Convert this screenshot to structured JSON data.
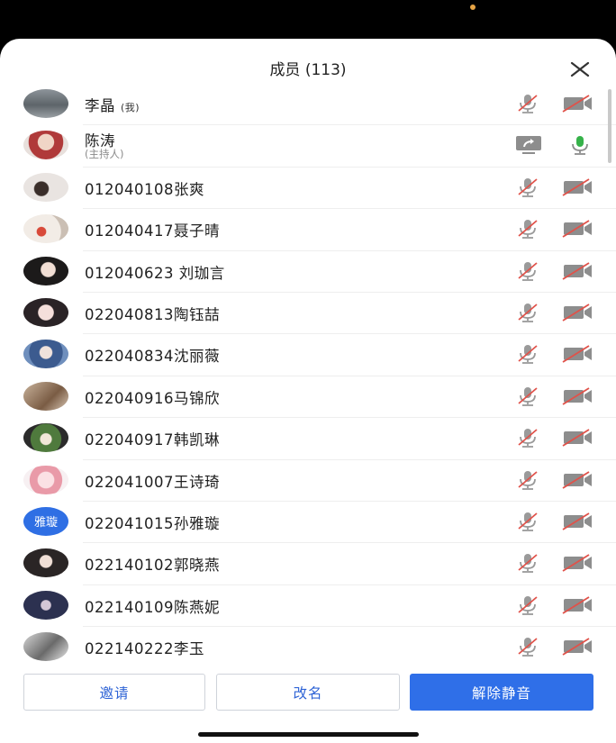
{
  "header": {
    "title": "成员 (113)",
    "close_icon": "close-icon"
  },
  "members": [
    {
      "name": "李晶",
      "tag": "(我)",
      "avatar": "photo-gray",
      "mic": "muted",
      "camera": "off"
    },
    {
      "name": "陈涛",
      "subtitle": "(主持人)",
      "avatar": "photo-red",
      "mic": "active",
      "camera": "screen-share"
    },
    {
      "name": "012040108张爽",
      "avatar": "photo-light",
      "mic": "muted",
      "camera": "off"
    },
    {
      "name": "012040417聂子晴",
      "avatar": "photo-beige",
      "mic": "muted",
      "camera": "off"
    },
    {
      "name": "012040623 刘珈言",
      "avatar": "photo-dark",
      "mic": "muted",
      "camera": "off"
    },
    {
      "name": "022040813陶钰喆",
      "avatar": "photo-pink",
      "mic": "muted",
      "camera": "off"
    },
    {
      "name": "022040834沈丽薇",
      "avatar": "photo-blue",
      "mic": "muted",
      "camera": "off"
    },
    {
      "name": "022040916马锦欣",
      "avatar": "photo-tan",
      "mic": "muted",
      "camera": "off"
    },
    {
      "name": "022040917韩凯琳",
      "avatar": "photo-green",
      "mic": "muted",
      "camera": "off"
    },
    {
      "name": "022041007王诗琦",
      "avatar": "photo-anime",
      "mic": "muted",
      "camera": "off"
    },
    {
      "name": "022041015孙雅璇",
      "avatar_text": "雅璇",
      "mic": "muted",
      "camera": "off"
    },
    {
      "name": "022140102郭晓燕",
      "avatar": "photo-portrait",
      "mic": "muted",
      "camera": "off"
    },
    {
      "name": "022140109陈燕妮",
      "avatar": "photo-navy",
      "mic": "muted",
      "camera": "off"
    },
    {
      "name": "022140222李玉",
      "avatar": "photo-bw",
      "mic": "muted",
      "camera": "off"
    }
  ],
  "footer": {
    "invite_label": "邀请",
    "rename_label": "改名",
    "unmute_label": "解除静音"
  },
  "colors": {
    "accent": "#2f6fe8",
    "muted_red": "#e0524a",
    "mic_green": "#36b24a",
    "icon_gray": "#8d8d8d"
  }
}
